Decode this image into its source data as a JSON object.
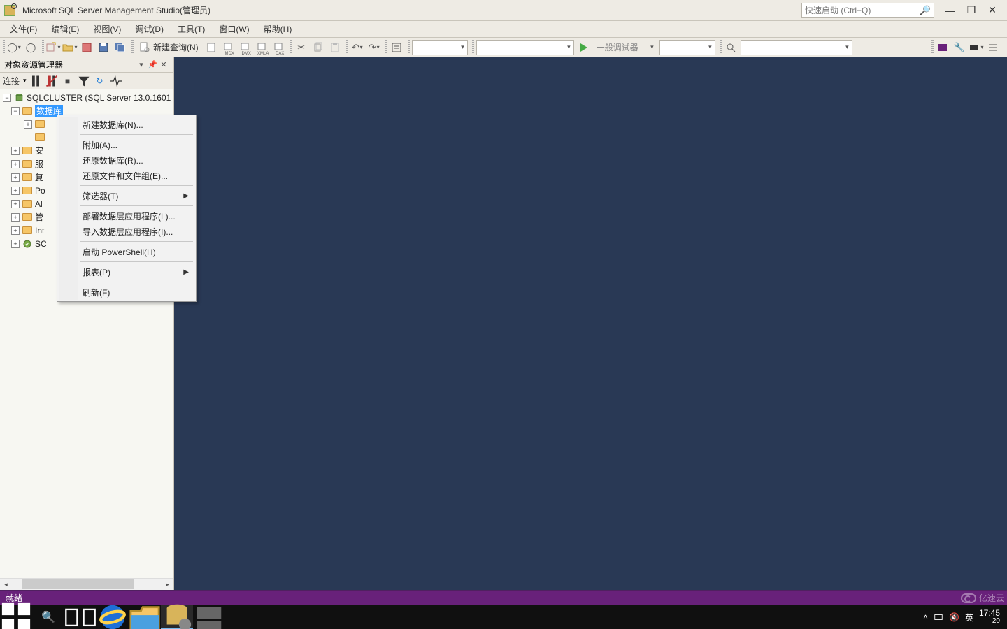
{
  "title": "Microsoft SQL Server Management Studio(管理员)",
  "quick_launch_placeholder": "快速启动 (Ctrl+Q)",
  "menubar": [
    "文件(F)",
    "编辑(E)",
    "视图(V)",
    "调试(D)",
    "工具(T)",
    "窗口(W)",
    "帮助(H)"
  ],
  "toolbar": {
    "new_query": "新建查询(N)",
    "debug_label": "一般调试器"
  },
  "object_explorer": {
    "title": "对象资源管理器",
    "connect_label": "连接",
    "server": "SQLCLUSTER (SQL Server 13.0.1601",
    "selected_node": "数据库",
    "nodes": [
      {
        "label": "安",
        "partial": true
      },
      {
        "label": "服",
        "partial": true
      },
      {
        "label": "复",
        "partial": true
      },
      {
        "label": "Po",
        "partial": true
      },
      {
        "label": "Al",
        "partial": true
      },
      {
        "label": "管",
        "partial": true
      },
      {
        "label": "Int",
        "partial": true
      },
      {
        "label": "SC",
        "partial": true,
        "icon": "agent"
      }
    ]
  },
  "context_menu": {
    "items": [
      {
        "label": "新建数据库(N)...",
        "type": "item"
      },
      {
        "type": "sep"
      },
      {
        "label": "附加(A)...",
        "type": "item"
      },
      {
        "label": "还原数据库(R)...",
        "type": "item"
      },
      {
        "label": "还原文件和文件组(E)...",
        "type": "item"
      },
      {
        "type": "sep"
      },
      {
        "label": "筛选器(T)",
        "type": "submenu"
      },
      {
        "type": "sep"
      },
      {
        "label": "部署数据层应用程序(L)...",
        "type": "item"
      },
      {
        "label": "导入数据层应用程序(I)...",
        "type": "item"
      },
      {
        "type": "sep"
      },
      {
        "label": "启动 PowerShell(H)",
        "type": "item"
      },
      {
        "type": "sep"
      },
      {
        "label": "报表(P)",
        "type": "submenu"
      },
      {
        "type": "sep"
      },
      {
        "label": "刷新(F)",
        "type": "item"
      }
    ]
  },
  "statusbar": {
    "text": "就绪"
  },
  "taskbar": {
    "tray": {
      "ime": "英",
      "date_count": "20",
      "time": "17:45"
    }
  },
  "watermark": "亿速云"
}
